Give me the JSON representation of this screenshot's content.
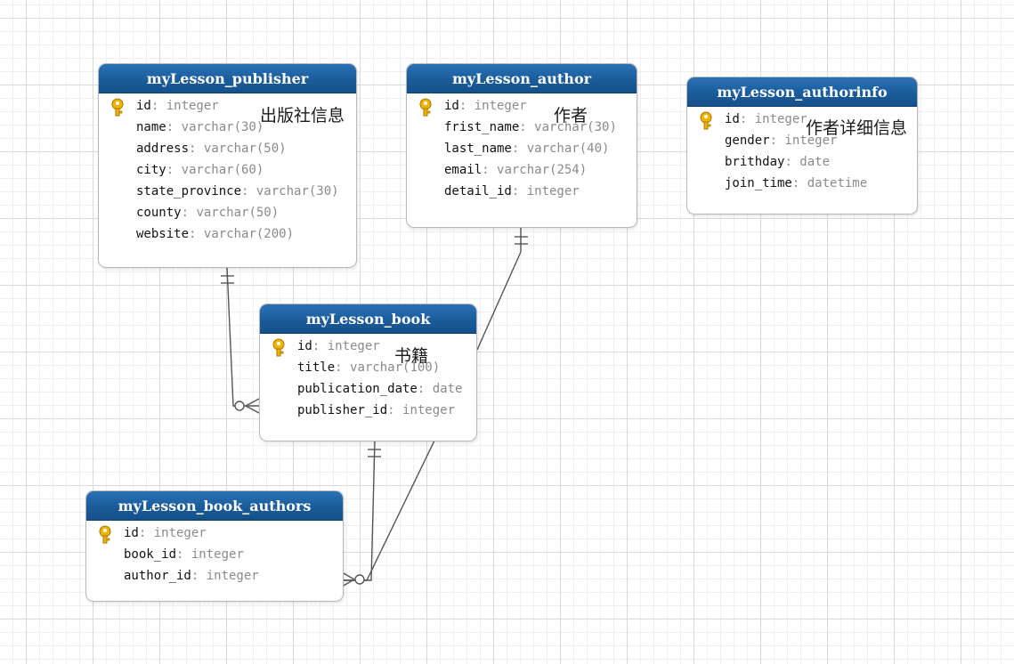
{
  "entities": {
    "publisher": {
      "title": "myLesson_publisher",
      "fields": [
        {
          "name": "id",
          "type": "integer",
          "pk": true
        },
        {
          "name": "name",
          "type": "varchar(30)"
        },
        {
          "name": "address",
          "type": "varchar(50)"
        },
        {
          "name": "city",
          "type": "varchar(60)"
        },
        {
          "name": "state_province",
          "type": "varchar(30)"
        },
        {
          "name": "county",
          "type": "varchar(50)"
        },
        {
          "name": "website",
          "type": "varchar(200)"
        }
      ]
    },
    "author": {
      "title": "myLesson_author",
      "fields": [
        {
          "name": "id",
          "type": "integer",
          "pk": true
        },
        {
          "name": "frist_name",
          "type": "varchar(30)"
        },
        {
          "name": "last_name",
          "type": "varchar(40)"
        },
        {
          "name": "email",
          "type": "varchar(254)"
        },
        {
          "name": "detail_id",
          "type": "integer"
        }
      ]
    },
    "authorinfo": {
      "title": "myLesson_authorinfo",
      "fields": [
        {
          "name": "id",
          "type": "integer",
          "pk": true
        },
        {
          "name": "gender",
          "type": "integer"
        },
        {
          "name": "brithday",
          "type": "date"
        },
        {
          "name": "join_time",
          "type": "datetime"
        }
      ]
    },
    "book": {
      "title": "myLesson_book",
      "fields": [
        {
          "name": "id",
          "type": "integer",
          "pk": true
        },
        {
          "name": "title",
          "type": "varchar(100)"
        },
        {
          "name": "publication_date",
          "type": "date"
        },
        {
          "name": "publisher_id",
          "type": "integer"
        }
      ]
    },
    "book_authors": {
      "title": "myLesson_book_authors",
      "fields": [
        {
          "name": "id",
          "type": "integer",
          "pk": true
        },
        {
          "name": "book_id",
          "type": "integer"
        },
        {
          "name": "author_id",
          "type": "integer"
        }
      ]
    }
  },
  "notes": {
    "publisher": "出版社信息",
    "author": "作者",
    "authorinfo": "作者详细信息",
    "book": "书籍"
  },
  "relations": [
    {
      "from": "publisher",
      "to": "book",
      "from_end": "one",
      "to_end": "zero-or-many"
    },
    {
      "from": "author",
      "to": "book_authors",
      "from_end": "one",
      "to_end": "zero-or-many"
    },
    {
      "from": "book",
      "to": "book_authors",
      "from_end": "one",
      "to_end": "zero-or-many"
    }
  ],
  "colors": {
    "header": "#1b5c9b",
    "line": "#555555",
    "key": "#f0b400"
  }
}
